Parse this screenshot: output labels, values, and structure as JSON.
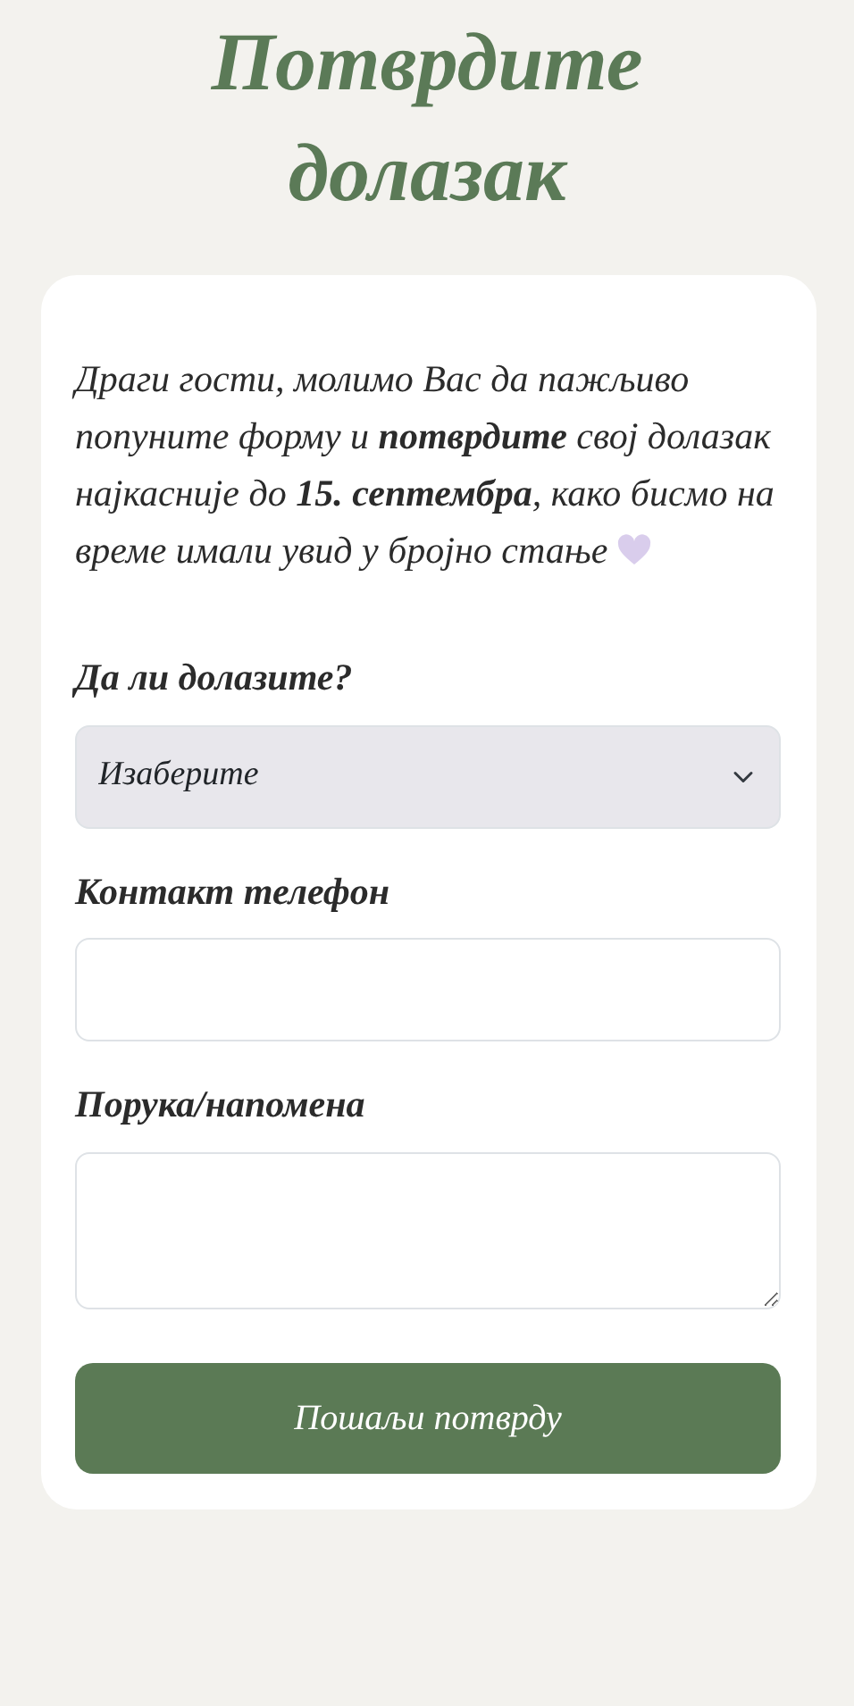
{
  "title": "Потврдите долазак",
  "intro": "Драги гости, молимо Вас да пажљиво попуните форму и **потврдите** свој долазак најкасније до **15. септембра**, како бисмо на време имали увид у бројно стање",
  "fields": [
    {
      "kind": "select",
      "label": "Да ли долазите?",
      "value": "Изаберите"
    },
    {
      "kind": "input",
      "label": "Контакт телефон"
    },
    {
      "kind": "textarea",
      "label": "Порука/напомена"
    }
  ],
  "submit": "Пошаљи потврду"
}
